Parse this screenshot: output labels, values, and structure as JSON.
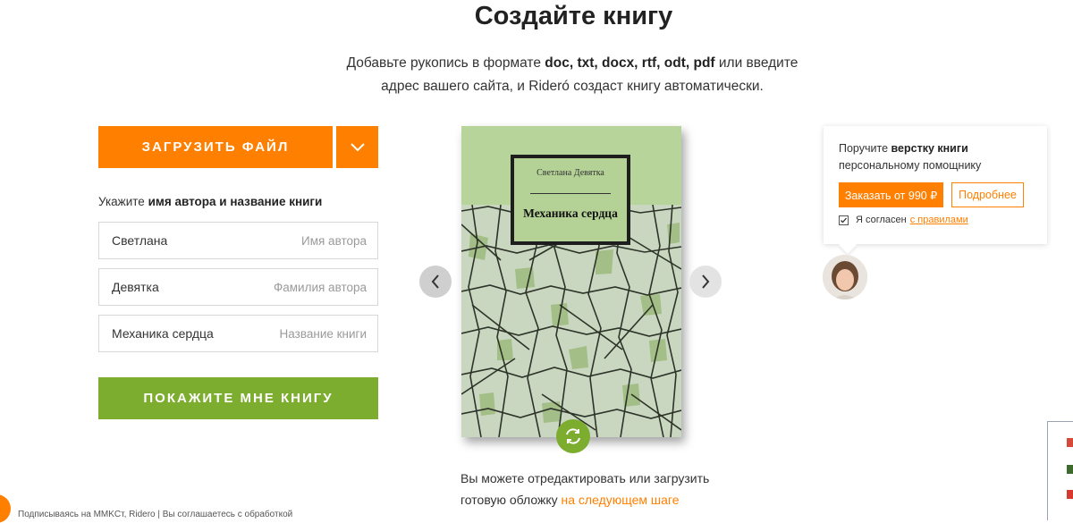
{
  "header": {
    "title": "Создайте книгу",
    "subtitle_prefix": "Добавьте рукопись в формате",
    "subtitle_formats": "doc, txt, docx, rtf, odt, pdf",
    "subtitle_suffix": "или введите адрес вашего сайта, и Rideró создаст книгу автоматически."
  },
  "form": {
    "upload_label": "ЗАГРУЗИТЬ ФАЙЛ",
    "hint_prefix": "Укажите",
    "hint_bold": "имя автора и название книги",
    "fields": [
      {
        "value": "Светлана",
        "placeholder": "Имя автора"
      },
      {
        "value": "Девятка",
        "placeholder": "Фамилия автора"
      },
      {
        "value": "Механика сердца",
        "placeholder": "Название книги"
      }
    ],
    "show_label": "ПОКАЖИТЕ МНЕ КНИГУ"
  },
  "book": {
    "author": "Светлана Девятка",
    "title": "Механика сердца"
  },
  "cover_note": {
    "text": "Вы можете отредактировать или загрузить готовую обложку",
    "link": "на следующем шаге"
  },
  "promo": {
    "prefix": "Поручите",
    "bold": "верстку книги",
    "suffix": "персональному помощнику",
    "order_label": "Заказать от 990 ₽",
    "more_label": "Подробнее",
    "agree_text": "Я согласен",
    "agree_link": "с правилами"
  },
  "footer": {
    "text": "Подписываясь на MMKСт, Ridero | Вы соглашаетесь с обработкой"
  },
  "colors": {
    "accent": "#ff7f00",
    "green": "#7dad2f"
  },
  "icons": [
    "chevron-down-icon",
    "chevron-left-icon",
    "chevron-right-icon",
    "refresh-icon",
    "checkbox-icon"
  ]
}
